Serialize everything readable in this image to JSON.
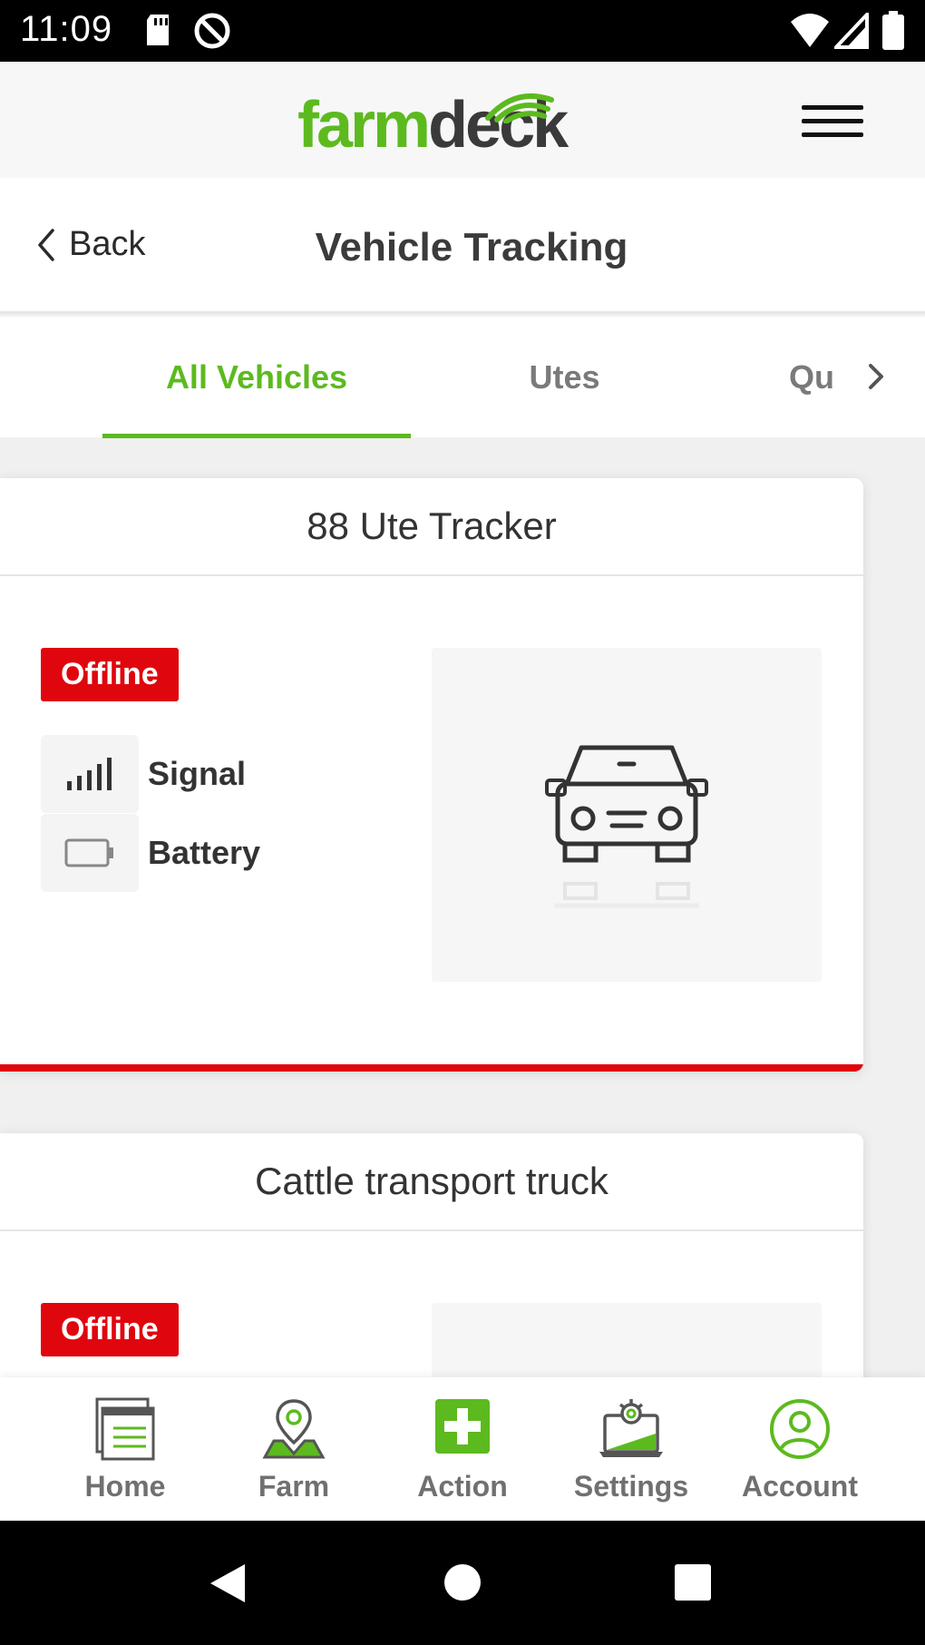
{
  "status_bar": {
    "time": "11:09"
  },
  "app": {
    "brand_part1": "farm",
    "brand_part2": "deck"
  },
  "page": {
    "back_label": "Back",
    "title": "Vehicle Tracking"
  },
  "tabs": [
    {
      "label": "All Vehicles",
      "active": true
    },
    {
      "label": "Utes",
      "active": false
    },
    {
      "label": "Qu",
      "active": false
    }
  ],
  "vehicles": [
    {
      "name": "88 Ute Tracker",
      "status": "Offline",
      "signal_label": "Signal",
      "battery_label": "Battery"
    },
    {
      "name": "Cattle transport truck",
      "status": "Offline"
    }
  ],
  "bottom_nav": [
    {
      "label": "Home",
      "icon": "home-icon"
    },
    {
      "label": "Farm",
      "icon": "map-pin-icon"
    },
    {
      "label": "Action",
      "icon": "plus-icon"
    },
    {
      "label": "Settings",
      "icon": "settings-laptop-icon"
    },
    {
      "label": "Account",
      "icon": "account-icon"
    }
  ],
  "colors": {
    "brand_green": "#5cba1f",
    "offline_red": "#e0060d",
    "text_dark": "#333333"
  }
}
